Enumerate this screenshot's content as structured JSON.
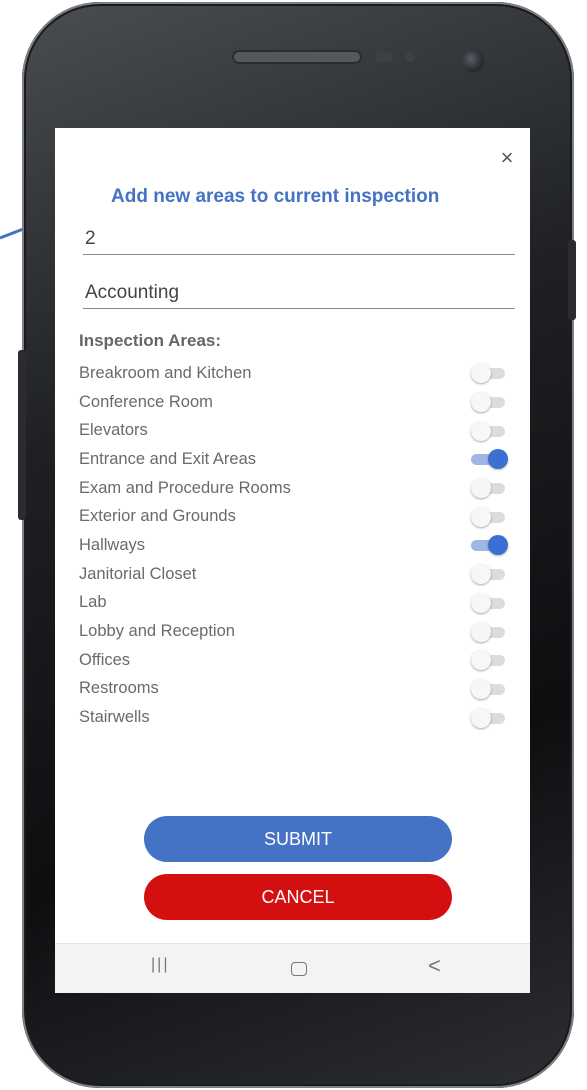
{
  "dialog": {
    "title": "Add new areas to current inspection",
    "close_icon": "×",
    "area_number_value": "2",
    "department_value": "Accounting",
    "section_label": "Inspection Areas:",
    "areas": [
      {
        "label": "Breakroom and Kitchen",
        "enabled": false
      },
      {
        "label": "Conference Room",
        "enabled": false
      },
      {
        "label": "Elevators",
        "enabled": false
      },
      {
        "label": "Entrance and Exit Areas",
        "enabled": true
      },
      {
        "label": "Exam and Procedure Rooms",
        "enabled": false
      },
      {
        "label": "Exterior and Grounds",
        "enabled": false
      },
      {
        "label": "Hallways",
        "enabled": true
      },
      {
        "label": "Janitorial Closet",
        "enabled": false
      },
      {
        "label": "Lab",
        "enabled": false
      },
      {
        "label": "Lobby and Reception",
        "enabled": false
      },
      {
        "label": "Offices",
        "enabled": false
      },
      {
        "label": "Restrooms",
        "enabled": false
      },
      {
        "label": "Stairwells",
        "enabled": false
      }
    ],
    "submit_label": "SUBMIT",
    "cancel_label": "CANCEL"
  },
  "navbar": {
    "recent_icon": "|||",
    "back_icon": "<"
  },
  "colors": {
    "accent": "#4472c4",
    "cancel": "#d40f0f",
    "toggle_on": "#3b6fd1"
  }
}
